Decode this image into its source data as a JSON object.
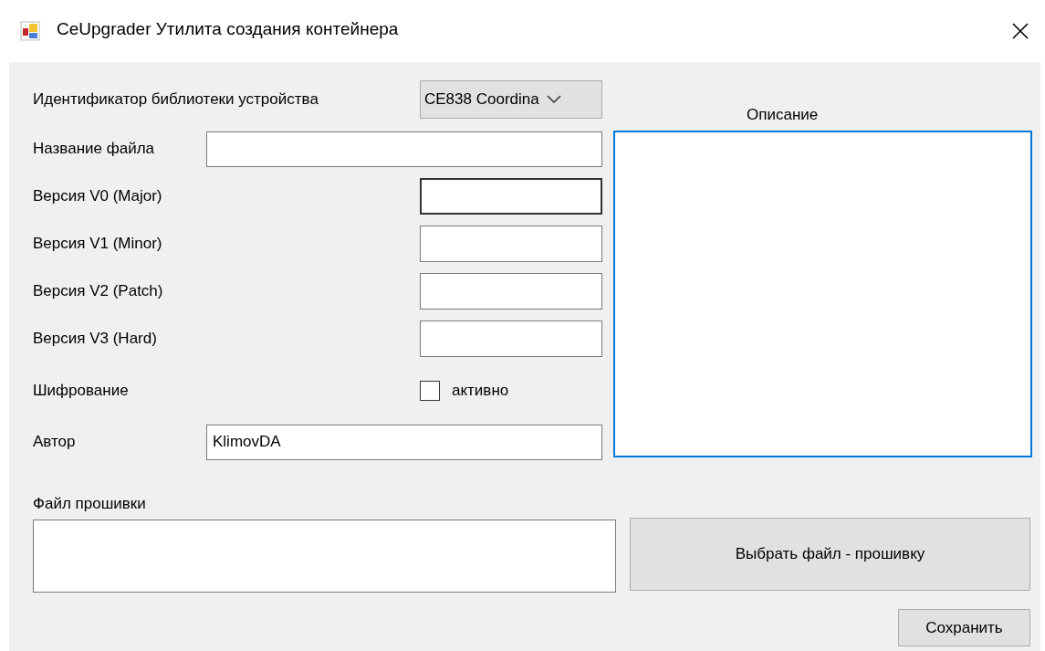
{
  "window": {
    "title": "CeUpgrader Утилита создания контейнера"
  },
  "device_library": {
    "label": "Идентификатор библиотеки устройства",
    "value": "CE838 Coordina"
  },
  "file_name": {
    "label": "Название файла"
  },
  "versions": [
    {
      "label": "Версия V0 (Major)",
      "hovered": true
    },
    {
      "label": "Версия V1 (Minor)",
      "hovered": false
    },
    {
      "label": "Версия V2 (Patch)",
      "hovered": false
    },
    {
      "label": "Версия V3 (Hard)",
      "hovered": false
    }
  ],
  "encryption": {
    "label": "Шифрование",
    "checkbox_label": "активно",
    "checked": false
  },
  "author": {
    "label": "Автор",
    "value": "KlimovDA"
  },
  "description": {
    "label": "Описание",
    "focused": true
  },
  "firmware": {
    "label": "Файл прошивки",
    "button": "Выбрать файл - прошивку"
  },
  "save_button": "Сохранить"
}
